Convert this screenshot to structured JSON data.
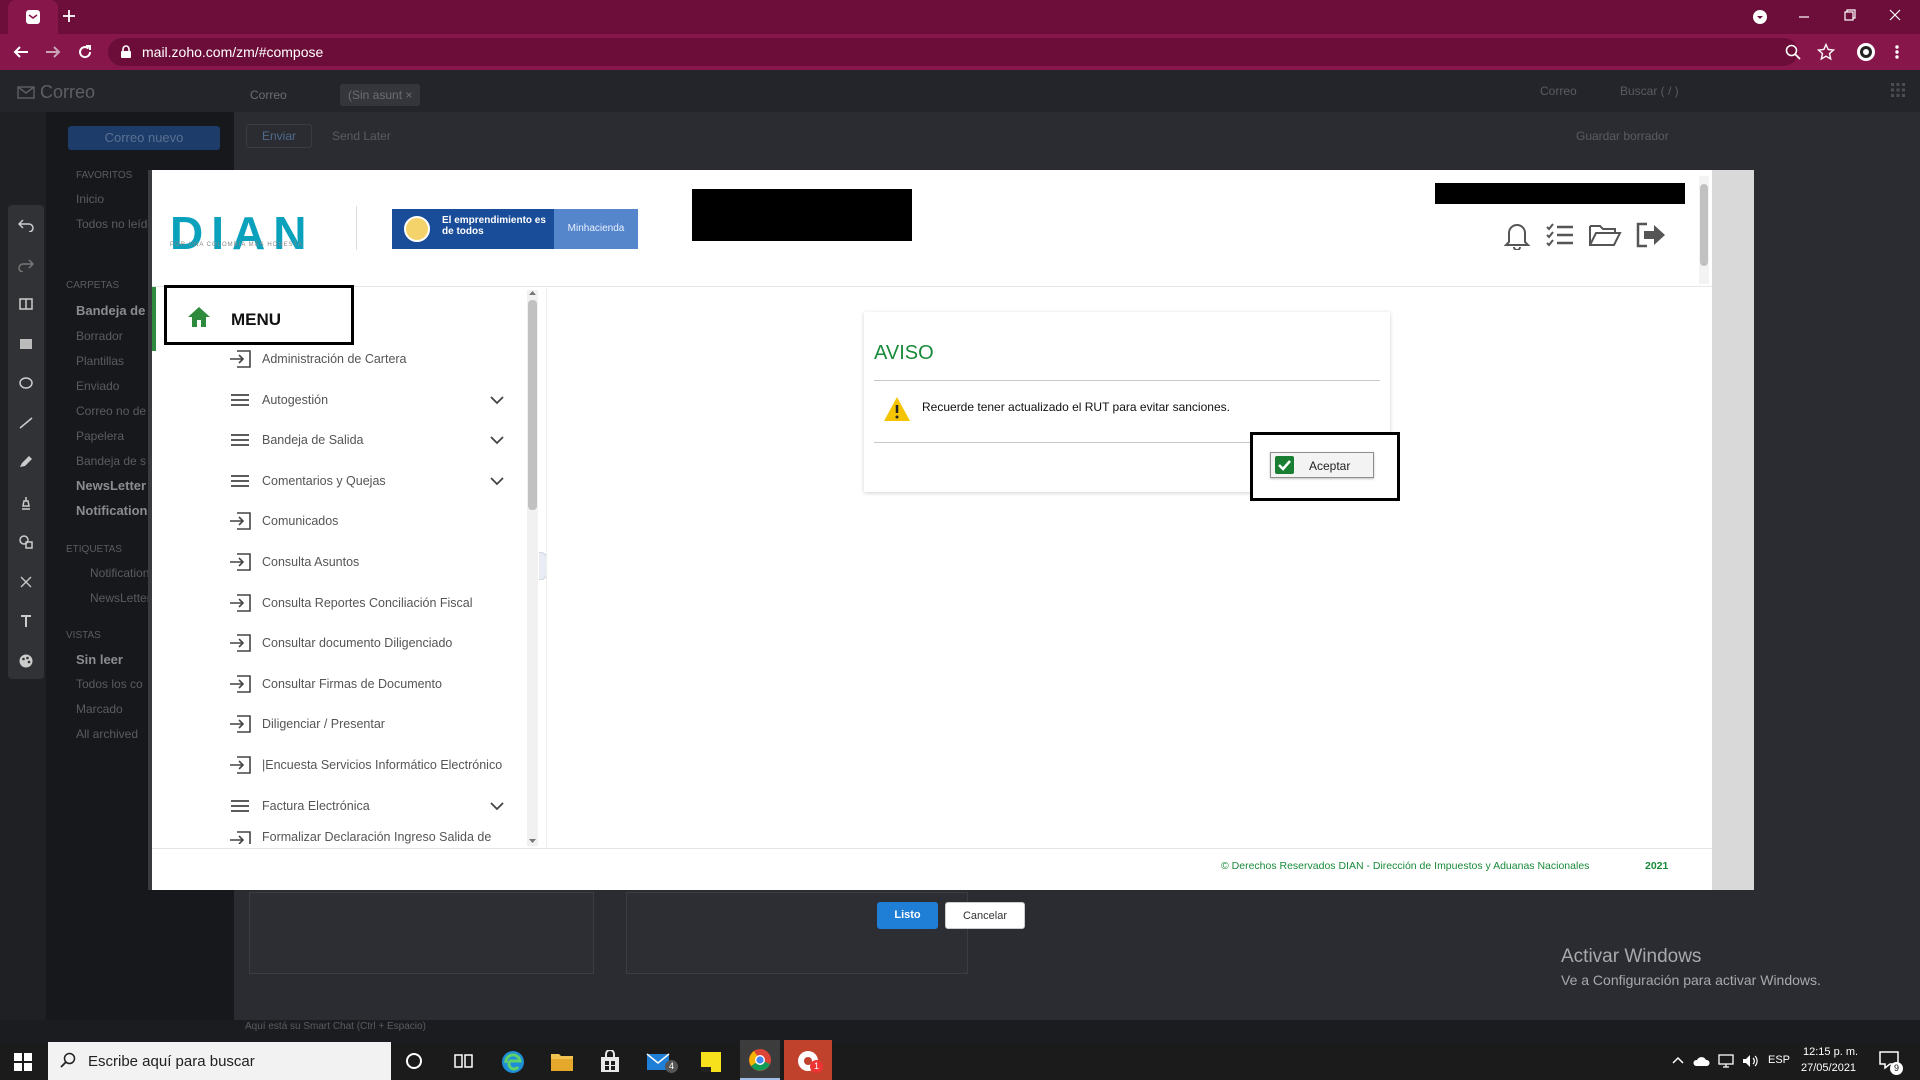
{
  "browser": {
    "url": "mail.zoho.com/zm/#compose",
    "accent": "#87174b"
  },
  "zoho": {
    "app_title": "Correo",
    "tabs": [
      "Correo",
      "(Sin asunt"
    ],
    "new_mail": "Correo nuevo",
    "send": "Enviar",
    "send_later": "Send Later",
    "search_scope": "Correo",
    "search_placeholder": "Buscar ( / )",
    "draft_status": "Guardar borrador",
    "sidebar_sections": {
      "favorites": "FAVORITOS",
      "folders": "CARPETAS",
      "tags": "ETIQUETAS",
      "views": "VISTAS"
    },
    "sidebar_items": [
      "Inicio",
      "Todos no leídos",
      "Bandeja de e",
      "Borrador",
      "Plantillas",
      "Enviado",
      "Correo no de",
      "Papelera",
      "Bandeja de s",
      "NewsLetter",
      "Notification",
      "Notification",
      "NewsLetter",
      "Sin leer",
      "Todos los co",
      "Marcado",
      "All archived"
    ],
    "chat_hint": "Aquí está su Smart Chat (Ctrl + Espacio)"
  },
  "dian": {
    "logo": "DIAN",
    "logo_tagline": "POR UNA COLOMBIA MÁS HONESTA",
    "banner_text": "El emprendimiento es de todos",
    "banner_ministry": "Minhacienda",
    "menu_title": "MENU",
    "menu_items": [
      {
        "label": "Administración de Cartera",
        "icon": "login-arrow-icon",
        "has_submenu": false
      },
      {
        "label": "Autogestión",
        "icon": "hamburger-icon",
        "has_submenu": true
      },
      {
        "label": "Bandeja de Salida",
        "icon": "hamburger-icon",
        "has_submenu": true
      },
      {
        "label": "Comentarios y Quejas",
        "icon": "hamburger-icon",
        "has_submenu": true
      },
      {
        "label": "Comunicados",
        "icon": "login-arrow-icon",
        "has_submenu": false
      },
      {
        "label": "Consulta Asuntos",
        "icon": "login-arrow-icon",
        "has_submenu": false
      },
      {
        "label": "Consulta Reportes Conciliación Fiscal",
        "icon": "login-arrow-icon",
        "has_submenu": false
      },
      {
        "label": "Consultar documento Diligenciado",
        "icon": "login-arrow-icon",
        "has_submenu": false
      },
      {
        "label": "Consultar Firmas de Documento",
        "icon": "login-arrow-icon",
        "has_submenu": false
      },
      {
        "label": "Diligenciar / Presentar",
        "icon": "login-arrow-icon",
        "has_submenu": false
      },
      {
        "label": "|Encuesta Servicios Informático Electrónico",
        "icon": "login-arrow-icon",
        "has_submenu": false
      },
      {
        "label": "Factura Electrónica",
        "icon": "hamburger-icon",
        "has_submenu": true
      },
      {
        "label": "Formalizar Declaración Ingreso Salida de",
        "icon": "login-arrow-icon",
        "has_submenu": false
      }
    ],
    "aviso_title": "AVISO",
    "aviso_message": "Recuerde tener actualizado el RUT para evitar sanciones.",
    "aceptar_label": "Aceptar",
    "footer_text": "© Derechos Reservados DIAN - Dirección de Impuestos y Aduanas Nacionales",
    "footer_year": "2021",
    "colors": {
      "green": "#198a3a",
      "teal": "#0aa1bc"
    }
  },
  "modal_buttons": {
    "done": "Listo",
    "cancel": "Cancelar"
  },
  "watermark": {
    "line1": "Activar Windows",
    "line2": "Ve a Configuración para activar Windows."
  },
  "taskbar": {
    "search_placeholder": "Escribe aquí para buscar",
    "language": "ESP",
    "time": "12:15 p. m.",
    "date": "27/05/2021",
    "mail_badge": "4",
    "notification_badge": "9",
    "photo_badge": "1"
  }
}
